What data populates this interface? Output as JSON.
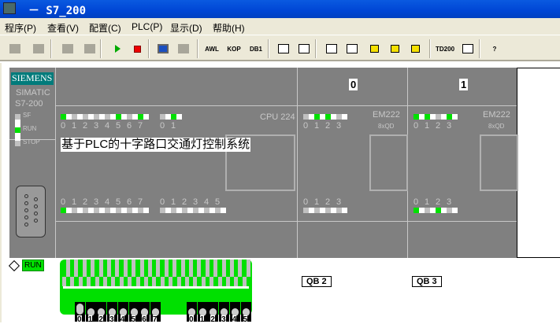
{
  "window": {
    "title": "－ S7_200"
  },
  "menu": [
    "程序(P)",
    "查看(V)",
    "配置(C)",
    "PLC(P)",
    "显示(D)",
    "帮助(H)"
  ],
  "toolbar": [
    {
      "icon": "erase-icon"
    },
    {
      "icon": "download-icon"
    },
    {
      "icon": "awl-doc-icon"
    },
    {
      "icon": "db1-doc-icon"
    },
    {
      "icon": "run-icon"
    },
    {
      "icon": "stop-icon"
    },
    {
      "icon": "cpu-monitor-icon"
    },
    {
      "icon": "cpu-disabled-icon"
    },
    {
      "icon": "awl-icon",
      "label": "AWL"
    },
    {
      "icon": "kop-icon",
      "label": "KOP"
    },
    {
      "icon": "db1-icon",
      "label": "DB1"
    },
    {
      "icon": "program-status-icon"
    },
    {
      "icon": "chart-status-icon"
    },
    {
      "icon": "glasses-icon"
    },
    {
      "icon": "write-icon"
    },
    {
      "icon": "lock-icon"
    },
    {
      "icon": "unlock-icon"
    },
    {
      "icon": "unlock-up-icon"
    },
    {
      "icon": "td200-icon",
      "label": "TD200"
    },
    {
      "icon": "force-cancel-icon"
    },
    {
      "icon": "help-icon",
      "label": "?"
    }
  ],
  "plc": {
    "brand": "SIEMENS",
    "model_line1": "SIMATIC",
    "model_line2": "S7-200",
    "status": [
      {
        "label": "SF",
        "on": false
      },
      {
        "label": "RUN",
        "on": true
      },
      {
        "label": "STOP",
        "on": false
      }
    ],
    "cpu": {
      "name": "CPU 224",
      "caption": "基于PLC的十字路口交通灯控制系统",
      "out0": {
        "labels": [
          "0",
          "1",
          "2",
          "3",
          "4",
          "5",
          "6",
          "7"
        ],
        "on": [
          1,
          0,
          0,
          0,
          0,
          1,
          0,
          1
        ]
      },
      "out1": {
        "labels": [
          "0",
          "1"
        ],
        "on": [
          0,
          1
        ]
      },
      "in0": {
        "labels": [
          "0",
          "1",
          "2",
          "3",
          "4",
          "5",
          "6",
          "7"
        ],
        "on": [
          1,
          0,
          0,
          0,
          0,
          0,
          0,
          0
        ]
      },
      "in1": {
        "labels": [
          "0",
          "1",
          "2",
          "3",
          "4",
          "5"
        ],
        "on": [
          0,
          0,
          0,
          0,
          0,
          0
        ]
      }
    },
    "modules": [
      {
        "slot": "0",
        "name": "EM222",
        "type": "8xQD",
        "top": {
          "labels": [
            "0",
            "1",
            "2",
            "3"
          ],
          "on": [
            0,
            1,
            1,
            0
          ]
        },
        "bottom": {
          "labels": [
            "0",
            "1",
            "2",
            "3"
          ],
          "on": [
            0,
            0,
            0,
            0
          ]
        },
        "qb": "QB 2"
      },
      {
        "slot": "1",
        "name": "EM222",
        "type": "8xQD",
        "top": {
          "labels": [
            "0",
            "1",
            "2",
            "3"
          ],
          "on": [
            1,
            1,
            0,
            1
          ]
        },
        "bottom": {
          "labels": [
            "0",
            "1",
            "2",
            "3"
          ],
          "on": [
            1,
            0,
            1,
            0
          ]
        },
        "qb": "QB 3"
      }
    ],
    "run_badge": "RUN",
    "switches": {
      "group0": {
        "labels": [
          "0",
          "1",
          "2",
          "3",
          "4",
          "5",
          "6",
          "7"
        ],
        "on": [
          1,
          0,
          0,
          0,
          0,
          0,
          0,
          0
        ]
      },
      "group1": {
        "labels": [
          "0",
          "1",
          "2",
          "3",
          "4",
          "5"
        ],
        "on": [
          0,
          0,
          0,
          0,
          0,
          0
        ]
      }
    }
  },
  "colors": {
    "led_on": "#00e000",
    "led_off": "#c0c0c0",
    "panel": "#808080",
    "brand": "#007b7b"
  }
}
